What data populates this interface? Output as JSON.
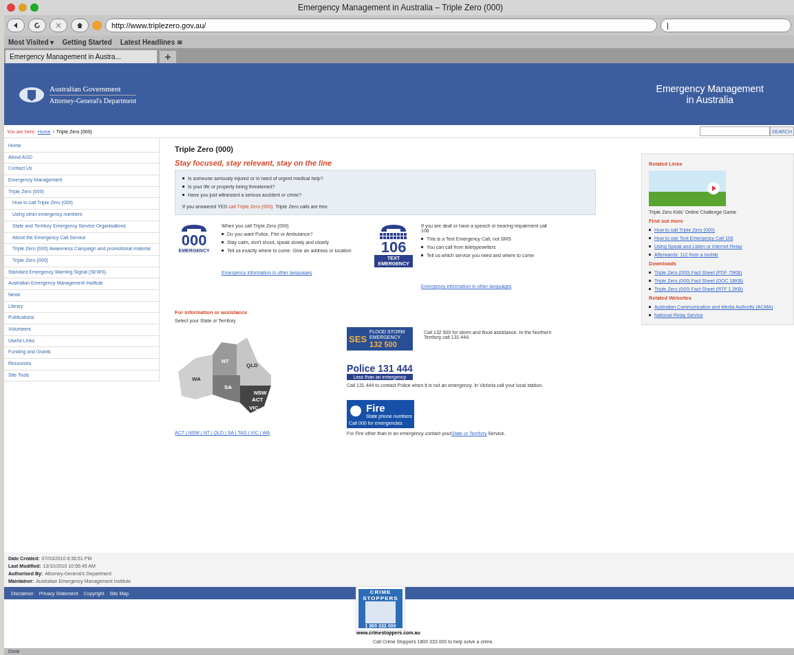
{
  "window": {
    "title": "Emergency Management in Australia – Triple Zero (000)"
  },
  "toolbar": {
    "url": "http://www.triplezero.gov.au/",
    "search_value": "|"
  },
  "bookmarks": [
    "Most Visited ▾",
    "Getting Started",
    "Latest Headlines ≋"
  ],
  "tabs": [
    {
      "label": "Emergency Management in Austra...",
      "selected": true
    }
  ],
  "header": {
    "gov_line_1": "Australian Government",
    "gov_line_2": "Attorney-General's Department",
    "site_title_1": "Emergency Management",
    "site_title_2": "in Australia"
  },
  "breadcrumb": {
    "label": "You are here:",
    "home": "Home",
    "separator": "›",
    "current": "Triple Zero (000)"
  },
  "site_search": {
    "button": "SEARCH"
  },
  "sidebar": {
    "items": [
      {
        "label": "Home"
      },
      {
        "label": "About AGD"
      },
      {
        "label": "Contact Us"
      },
      {
        "label": "Emergency Management"
      },
      {
        "label": "Triple Zero (000)",
        "children": [
          {
            "label": "How to call Triple Zero (000)"
          },
          {
            "label": "Using other emergency numbers"
          },
          {
            "label": "State and Territory Emergency Service Organisations"
          },
          {
            "label": "About the Emergency Call Service"
          },
          {
            "label": "Triple Zero (000) Awareness Campaign and promotional material"
          },
          {
            "label": "Triple Zero (000)"
          }
        ]
      },
      {
        "label": "Standard Emergency Warning Signal (SEWS)"
      },
      {
        "label": "Australian Emergency Management Institute"
      },
      {
        "label": "News"
      },
      {
        "label": "Library"
      },
      {
        "label": "Publications"
      },
      {
        "label": "Volunteers"
      },
      {
        "label": "Useful Links"
      },
      {
        "label": "Funding and Grants"
      },
      {
        "label": "Resources"
      },
      {
        "label": "Site Tools"
      }
    ]
  },
  "main": {
    "title": "Triple Zero (000)",
    "slogan": "Stay focused, stay relevant, stay on the line",
    "questions": [
      "Is someone seriously injured or in need of urgent medical help?",
      "Is your life or property being threatened?",
      "Have you just witnessed a serious accident or crime?"
    ],
    "answer": {
      "before": "If you answered YES",
      "highlight": "call Triple Zero (000).",
      "after": "Triple Zero calls are free."
    },
    "services": [
      {
        "kind": "emergency",
        "logo_number": "000",
        "logo_text": "EMERGENCY",
        "intro": "When you call Triple Zero (000)",
        "bullets": [
          "Do you want Police, Fire or Ambulance?",
          "Stay calm, don't shout, speak slowly and clearly",
          "Tell us exactly where to come. Give an address or location"
        ],
        "link": "Emergency information in other languages"
      },
      {
        "kind": "tty",
        "logo_number": "106",
        "logo_text": "TEXT EMERGENCY",
        "intro": "If you are deaf or have a speech or hearing impairment call 106",
        "bullets": [
          "This is a Text Emergency Call, not SMS",
          "You can call from teletypewriters",
          "Tell us which service you need and where to come"
        ],
        "link": "Emergency information in other languages"
      }
    ],
    "assist_heading": "For information or assistance",
    "assist_sub": "Select your State or Territory",
    "map_labels": [
      "WA",
      "NT",
      "QLD",
      "SA",
      "NSW",
      "ACT",
      "VIC"
    ],
    "state_links": "ACT | NSW | NT | QLD | SA | TAS | VIC | WA",
    "agencies": [
      {
        "kind": "ses",
        "logo": [
          "SES",
          "FLOOD STORM EMERGENCY",
          "132 500"
        ],
        "text": "Call 132 500 for storm and flood assistance. In the Northern Territory call 131 444."
      },
      {
        "kind": "police",
        "logo": [
          "Police 131 444",
          "Less than an emergency"
        ],
        "text": "Call 131 444 to contact Police when it is not an emergency. In Victoria call your local station."
      },
      {
        "kind": "fire",
        "logo": [
          "Fire",
          "State phone numbers",
          "Call 000 for emergencies"
        ],
        "text": "For Fire other than in an emergency contact your",
        "link": "State or Territory",
        "after": "Service."
      }
    ]
  },
  "related": {
    "heading": "Related Links",
    "game_caption": "Triple Zero Kids' Online Challenge Game",
    "sections": [
      {
        "heading": "Find out more",
        "links": [
          "How to call Triple Zero (000)",
          "How to use Text Emergency Call 106",
          "Using Speak and Listen or Internet Relay",
          "Afterwards: 112 from a mobile"
        ]
      },
      {
        "heading": "Downloads",
        "links": [
          "Triple Zero (000) Fact Sheet (PDF 79KB)",
          "Triple Zero (000) Fact Sheet (DOC 18KB)",
          "Triple Zero (000) Fact Sheet (RTF 1.2KB)"
        ]
      },
      {
        "heading": "Related Websites",
        "links": [
          "Australian Communication and Media Authority (ACMA)",
          "National Relay Service"
        ]
      }
    ]
  },
  "meta": [
    {
      "label": "Date Created:",
      "value": "07/03/2010 6:36:51 PM"
    },
    {
      "label": "Last Modified:",
      "value": "13/10/2010 10:55:45 AM"
    },
    {
      "label": "Authorised By:",
      "value": "Attorney-General's Department"
    },
    {
      "label": "Maintainer:",
      "value": "Australian Emergency Management Institute"
    }
  ],
  "footer_links": [
    "Disclaimer",
    "Privacy Statement",
    "Copyright",
    "Site Map"
  ],
  "crime_stoppers": {
    "logo_1": "CRIME",
    "logo_2": "STOPPERS",
    "number": "1 800 333 000",
    "url": "www.crimestoppers.com.au",
    "text": "Call Crime Stoppers 1800 333 000 to help solve a crime."
  },
  "status_bar": "Done"
}
